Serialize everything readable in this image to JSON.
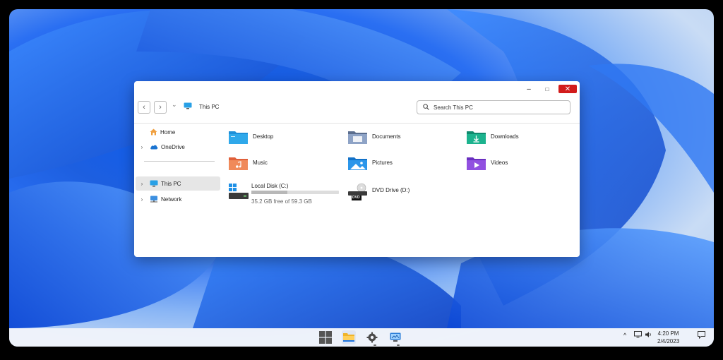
{
  "window": {
    "breadcrumb": "This PC",
    "search_placeholder": "Search This PC",
    "minimize_glyph": "–",
    "maximize_glyph": "□",
    "close_glyph": "✕"
  },
  "nav": {
    "back_glyph": "‹",
    "forward_glyph": "›",
    "recent_glyph": "⌄"
  },
  "sidebar": {
    "items": [
      {
        "label": "Home",
        "icon": "home-icon"
      },
      {
        "label": "OneDrive",
        "icon": "onedrive-icon"
      },
      {
        "label": "This PC",
        "icon": "monitor-icon"
      },
      {
        "label": "Network",
        "icon": "network-icon"
      }
    ]
  },
  "folders": [
    {
      "label": "Desktop",
      "icon": "desktop-folder-icon"
    },
    {
      "label": "Documents",
      "icon": "documents-folder-icon"
    },
    {
      "label": "Downloads",
      "icon": "downloads-folder-icon"
    },
    {
      "label": "Music",
      "icon": "music-folder-icon"
    },
    {
      "label": "Pictures",
      "icon": "pictures-folder-icon"
    },
    {
      "label": "Videos",
      "icon": "videos-folder-icon"
    }
  ],
  "drives": {
    "local": {
      "label": "Local Disk (C:)",
      "free_text": "35.2 GB free of 59.3 GB",
      "used_fraction": 0.41
    },
    "dvd": {
      "label": "DVD Drive (D:)",
      "badge": "DVD"
    }
  },
  "taskbar": {
    "tray_up_glyph": "^",
    "time": "4:20 PM",
    "date": "2/4/2023"
  },
  "colors": {
    "close": "#d21b1b",
    "accent": "#1a73e8"
  }
}
